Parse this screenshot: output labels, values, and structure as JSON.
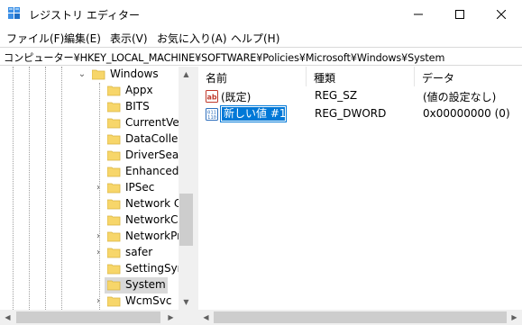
{
  "window": {
    "title": "レジストリ エディター",
    "icon": "registry-editor-icon"
  },
  "menu": {
    "items": [
      "ファイル(F)",
      "編集(E)",
      "表示(V)",
      "お気に入り(A)",
      "ヘルプ(H)"
    ]
  },
  "address": {
    "path": "コンピューター¥HKEY_LOCAL_MACHINE¥SOFTWARE¥Policies¥Microsoft¥Windows¥System"
  },
  "tree": {
    "parent": "Windows",
    "children": [
      "Appx",
      "BITS",
      "CurrentVers",
      "DataCollect",
      "DriverSearc",
      "EnhancedS",
      "IPSec",
      "Network Co",
      "NetworkCo",
      "NetworkPro",
      "safer",
      "SettingSync",
      "System",
      "WcmSvc"
    ],
    "selected": "System"
  },
  "list": {
    "headers": {
      "name": "名前",
      "type": "種類",
      "data": "データ"
    },
    "rows": [
      {
        "name": "(既定)",
        "type": "REG_SZ",
        "data": "(値の設定なし)",
        "icon": "string-value-icon"
      },
      {
        "name": "新しい値 #1",
        "type": "REG_DWORD",
        "data": "0x00000000 (0)",
        "icon": "binary-value-icon",
        "editing": true
      }
    ]
  },
  "colors": {
    "selection_blue": "#0078d7",
    "folder_yellow": "#f7d66a",
    "tree_selected": "#d9d9d9"
  }
}
